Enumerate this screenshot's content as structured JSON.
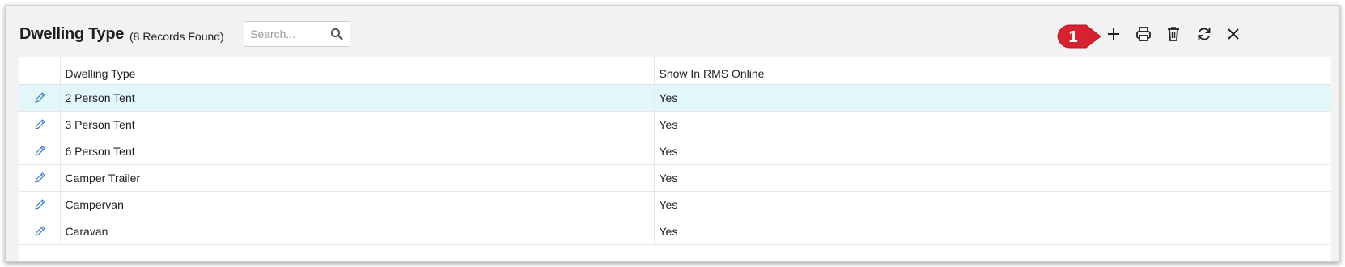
{
  "header": {
    "title": "Dwelling Type",
    "record_count": "(8 Records Found)"
  },
  "search": {
    "placeholder": "Search...",
    "value": ""
  },
  "callout_badge": "1",
  "toolbar": {
    "icons": [
      "plus-icon",
      "print-icon",
      "trash-icon",
      "refresh-icon",
      "close-icon"
    ]
  },
  "table": {
    "columns": [
      "",
      "Dwelling Type",
      "Show In RMS Online"
    ],
    "rows": [
      {
        "dwelling_type": "2 Person Tent",
        "show_online": "Yes",
        "selected": true
      },
      {
        "dwelling_type": "3 Person Tent",
        "show_online": "Yes",
        "selected": false
      },
      {
        "dwelling_type": "6 Person Tent",
        "show_online": "Yes",
        "selected": false
      },
      {
        "dwelling_type": "Camper Trailer",
        "show_online": "Yes",
        "selected": false
      },
      {
        "dwelling_type": "Campervan",
        "show_online": "Yes",
        "selected": false
      },
      {
        "dwelling_type": "Caravan",
        "show_online": "Yes",
        "selected": false
      }
    ]
  },
  "colors": {
    "badge": "#d62230",
    "selected_row": "#e3f7fb",
    "edit_icon": "#3a7bc8"
  }
}
